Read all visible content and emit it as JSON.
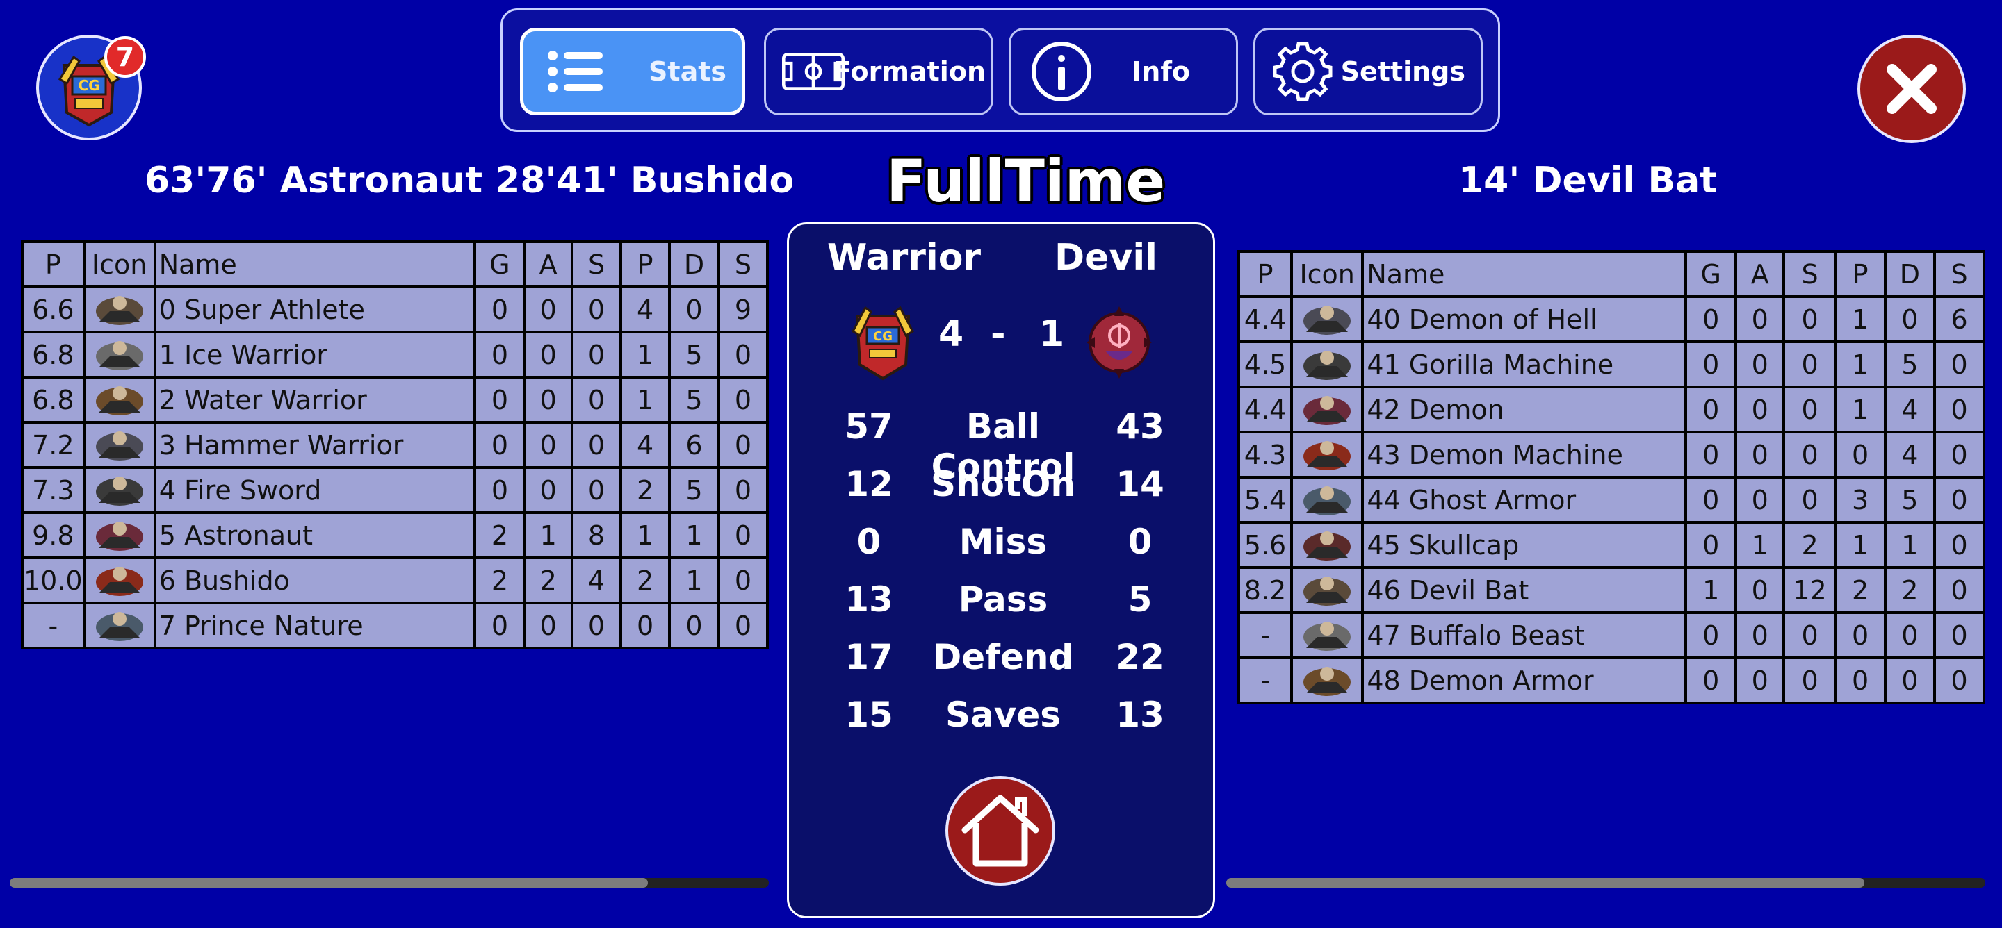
{
  "app": {
    "notification_count": "7",
    "status": "FullTime"
  },
  "tabs": [
    {
      "label": "Stats",
      "icon": "list-icon",
      "active": true
    },
    {
      "label": "Formation",
      "icon": "pitch-icon",
      "active": false
    },
    {
      "label": "Info",
      "icon": "info-icon",
      "active": false
    },
    {
      "label": "Settings",
      "icon": "gear-icon",
      "active": false
    }
  ],
  "home_team": {
    "name": "Warrior",
    "score": "4",
    "scorers": "63'76' Astronaut  28'41' Bushido",
    "columns": [
      "P",
      "Icon",
      "Name",
      "G",
      "A",
      "S",
      "P",
      "D",
      "S"
    ],
    "players": [
      {
        "p": "6.6",
        "name": "0 Super Athlete",
        "g": "0",
        "a": "0",
        "s": "0",
        "pa": "4",
        "d": "0",
        "sv": "9"
      },
      {
        "p": "6.8",
        "name": "1 Ice Warrior",
        "g": "0",
        "a": "0",
        "s": "0",
        "pa": "1",
        "d": "5",
        "sv": "0"
      },
      {
        "p": "6.8",
        "name": "2 Water Warrior",
        "g": "0",
        "a": "0",
        "s": "0",
        "pa": "1",
        "d": "5",
        "sv": "0"
      },
      {
        "p": "7.2",
        "name": "3 Hammer Warrior",
        "g": "0",
        "a": "0",
        "s": "0",
        "pa": "4",
        "d": "6",
        "sv": "0"
      },
      {
        "p": "7.3",
        "name": "4 Fire Sword",
        "g": "0",
        "a": "0",
        "s": "0",
        "pa": "2",
        "d": "5",
        "sv": "0"
      },
      {
        "p": "9.8",
        "name": "5 Astronaut",
        "g": "2",
        "a": "1",
        "s": "8",
        "pa": "1",
        "d": "1",
        "sv": "0"
      },
      {
        "p": "10.0",
        "name": "6 Bushido",
        "g": "2",
        "a": "2",
        "s": "4",
        "pa": "2",
        "d": "1",
        "sv": "0"
      },
      {
        "p": "-",
        "name": "7 Prince Nature",
        "g": "0",
        "a": "0",
        "s": "0",
        "pa": "0",
        "d": "0",
        "sv": "0"
      }
    ]
  },
  "away_team": {
    "name": "Devil",
    "score": "1",
    "scorers": "14' Devil Bat",
    "columns": [
      "P",
      "Icon",
      "Name",
      "G",
      "A",
      "S",
      "P",
      "D",
      "S"
    ],
    "players": [
      {
        "p": "4.4",
        "name": "40 Demon of Hell",
        "g": "0",
        "a": "0",
        "s": "0",
        "pa": "1",
        "d": "0",
        "sv": "6"
      },
      {
        "p": "4.5",
        "name": "41 Gorilla Machine",
        "g": "0",
        "a": "0",
        "s": "0",
        "pa": "1",
        "d": "5",
        "sv": "0"
      },
      {
        "p": "4.4",
        "name": "42 Demon",
        "g": "0",
        "a": "0",
        "s": "0",
        "pa": "1",
        "d": "4",
        "sv": "0"
      },
      {
        "p": "4.3",
        "name": "43 Demon Machine",
        "g": "0",
        "a": "0",
        "s": "0",
        "pa": "0",
        "d": "4",
        "sv": "0"
      },
      {
        "p": "5.4",
        "name": "44 Ghost Armor",
        "g": "0",
        "a": "0",
        "s": "0",
        "pa": "3",
        "d": "5",
        "sv": "0"
      },
      {
        "p": "5.6",
        "name": "45 Skullcap",
        "g": "0",
        "a": "1",
        "s": "2",
        "pa": "1",
        "d": "1",
        "sv": "0"
      },
      {
        "p": "8.2",
        "name": "46 Devil Bat",
        "g": "1",
        "a": "0",
        "s": "12",
        "pa": "2",
        "d": "2",
        "sv": "0"
      },
      {
        "p": "-",
        "name": "47 Buffalo Beast",
        "g": "0",
        "a": "0",
        "s": "0",
        "pa": "0",
        "d": "0",
        "sv": "0"
      },
      {
        "p": "-",
        "name": "48 Demon Armor",
        "g": "0",
        "a": "0",
        "s": "0",
        "pa": "0",
        "d": "0",
        "sv": "0"
      }
    ]
  },
  "match_stats": {
    "score_separator": "-",
    "rows": [
      {
        "label": "Ball Control",
        "home": "57",
        "away": "43"
      },
      {
        "label": "ShotOn",
        "home": "12",
        "away": "14"
      },
      {
        "label": "Miss",
        "home": "0",
        "away": "0"
      },
      {
        "label": "Pass",
        "home": "13",
        "away": "5"
      },
      {
        "label": "Defend",
        "home": "17",
        "away": "22"
      },
      {
        "label": "Saves",
        "home": "15",
        "away": "13"
      }
    ]
  },
  "colors": {
    "background": "#0000a6",
    "active_tab": "#4a93f5",
    "table_cell": "#9fa3d6",
    "close_button": "#9b1a1a"
  }
}
